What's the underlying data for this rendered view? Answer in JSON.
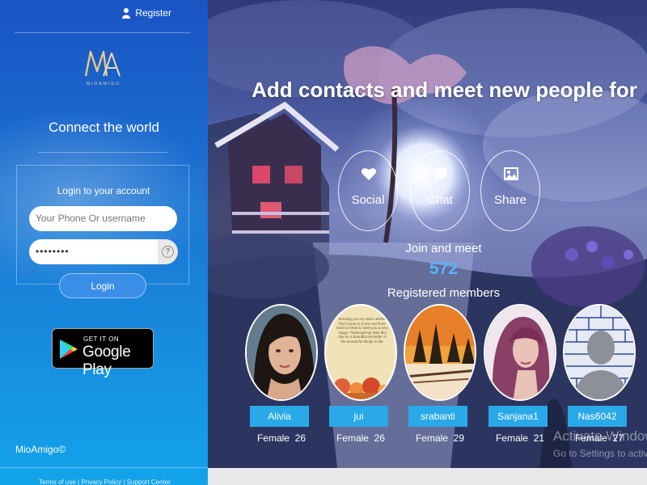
{
  "sidebar": {
    "register_label": "Register",
    "logo_text": "MIOAMIGO",
    "tagline": "Connect the world",
    "login": {
      "title": "Login to your account",
      "username_placeholder": "Your Phone Or username",
      "password_value": "••••••••",
      "help_symbol": "?",
      "login_label": "Login"
    },
    "google_play": {
      "line1": "GET IT ON",
      "line2": "Google Play"
    },
    "brand": "MioAmigo©",
    "footer_links": [
      "Terms of use",
      "Privacy Policy",
      "Support Center"
    ]
  },
  "hero": {
    "title": "Add contacts and meet new people for",
    "features": [
      {
        "label": "Social",
        "icon": "heart-icon"
      },
      {
        "label": "Chat",
        "icon": "chat-bubble-icon"
      },
      {
        "label": "Share",
        "icon": "image-icon"
      }
    ],
    "join_text": "Join and meet",
    "member_count": "572",
    "registered_text": "Registered members",
    "members": [
      {
        "name": "Alivia",
        "gender": "Female",
        "age": "26"
      },
      {
        "name": "jui",
        "gender": "Female",
        "age": "26"
      },
      {
        "name": "srabanti",
        "gender": "Female",
        "age": "29"
      },
      {
        "name": "Sanjana1",
        "gender": "Female",
        "age": "21"
      },
      {
        "name": "Nas6042",
        "gender": "Female",
        "age": "27"
      }
    ],
    "card_text": "Sending you my warm wishes from home to home and from heart to heart to wish you a very happy Thanksgiving! May this day be a beautiful reminder of the wonderful things in life.",
    "watermark_line1": "Activate Windows",
    "watermark_line2": "Go to Settings to activate"
  },
  "colors": {
    "accent": "#29a9e8",
    "count": "#5ab4ff",
    "sidebar_top": "#1a54c4",
    "sidebar_bottom": "#12a4ea"
  }
}
